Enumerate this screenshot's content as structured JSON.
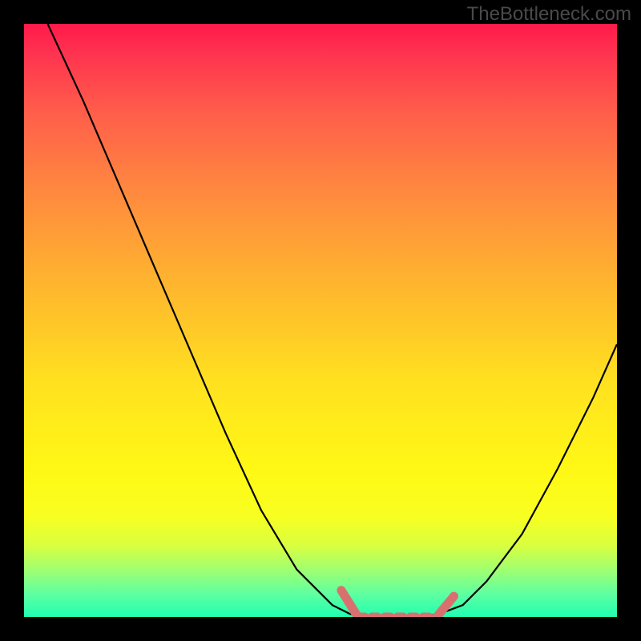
{
  "watermark": "TheBottleneck.com",
  "chart_data": {
    "type": "line",
    "title": "",
    "xlabel": "",
    "ylabel": "",
    "series": [
      {
        "name": "curve",
        "x": [
          0.04,
          0.1,
          0.16,
          0.22,
          0.28,
          0.34,
          0.4,
          0.46,
          0.52,
          0.55,
          0.58,
          0.62,
          0.66,
          0.7,
          0.74,
          0.78,
          0.84,
          0.9,
          0.96,
          1.0
        ],
        "y": [
          1.0,
          0.87,
          0.73,
          0.59,
          0.45,
          0.31,
          0.18,
          0.08,
          0.02,
          0.005,
          0.0,
          0.0,
          0.0,
          0.005,
          0.02,
          0.06,
          0.14,
          0.25,
          0.37,
          0.46
        ]
      }
    ],
    "xlim": [
      0,
      1
    ],
    "ylim": [
      0,
      1
    ],
    "highlight_range_x": [
      0.55,
      0.7
    ],
    "colors": {
      "curve": "#000000",
      "highlight": "#d97070",
      "gradient_top": "#ff1a4a",
      "gradient_bottom": "#20ffb0"
    }
  }
}
